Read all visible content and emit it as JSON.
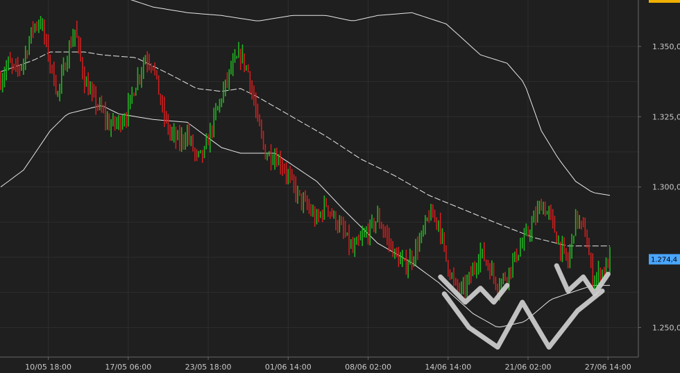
{
  "chart_data": {
    "type": "bar",
    "title": "",
    "xlabel": "",
    "ylabel": "",
    "grid": true,
    "ylim": [
      1.2395,
      1.3665
    ],
    "x_tick_labels": [
      "10/05 18:00",
      "17/05 06:00",
      "23/05 18:00",
      "01/06 14:00",
      "08/06 02:00",
      "14/06 14:00",
      "21/06 02:00",
      "27/06 14:00"
    ],
    "y_tick_labels": [
      {
        "label": "1.350,0",
        "value": 1.35
      },
      {
        "label": "1.325,0",
        "value": 1.325
      },
      {
        "label": "1.300,0",
        "value": 1.3
      },
      {
        "label": "1.250,0",
        "value": 1.25
      }
    ],
    "current_price": {
      "label": "1.274,4",
      "value": 1.2744
    },
    "top_price_tag_color": "#f0b000",
    "current_price_tag_color": "#4aa6ff",
    "up_color": "#22b322",
    "down_color": "#cc1f1f",
    "band_color": "#e8e8e8",
    "annotation_color": "#cfcfcf",
    "price_path": [
      [
        0,
        1.338
      ],
      [
        4,
        1.344
      ],
      [
        8,
        1.341
      ],
      [
        12,
        1.345
      ],
      [
        17,
        1.357
      ],
      [
        21,
        1.359
      ],
      [
        26,
        1.344
      ],
      [
        30,
        1.333
      ],
      [
        35,
        1.347
      ],
      [
        39,
        1.356
      ],
      [
        44,
        1.338
      ],
      [
        48,
        1.332
      ],
      [
        53,
        1.327
      ],
      [
        57,
        1.322
      ],
      [
        62,
        1.323
      ],
      [
        66,
        1.326
      ],
      [
        71,
        1.337
      ],
      [
        76,
        1.346
      ],
      [
        80,
        1.344
      ],
      [
        85,
        1.327
      ],
      [
        89,
        1.319
      ],
      [
        94,
        1.316
      ],
      [
        98,
        1.319
      ],
      [
        103,
        1.31
      ],
      [
        107,
        1.312
      ],
      [
        112,
        1.324
      ],
      [
        116,
        1.332
      ],
      [
        121,
        1.342
      ],
      [
        126,
        1.347
      ],
      [
        130,
        1.341
      ],
      [
        135,
        1.323
      ],
      [
        139,
        1.312
      ],
      [
        144,
        1.311
      ],
      [
        148,
        1.308
      ],
      [
        153,
        1.301
      ],
      [
        157,
        1.296
      ],
      [
        162,
        1.292
      ],
      [
        166,
        1.288
      ],
      [
        171,
        1.294
      ],
      [
        175,
        1.289
      ],
      [
        180,
        1.284
      ],
      [
        185,
        1.277
      ],
      [
        189,
        1.281
      ],
      [
        194,
        1.285
      ],
      [
        198,
        1.289
      ],
      [
        203,
        1.282
      ],
      [
        207,
        1.276
      ],
      [
        212,
        1.272
      ],
      [
        216,
        1.275
      ],
      [
        221,
        1.282
      ],
      [
        225,
        1.29
      ],
      [
        230,
        1.288
      ],
      [
        234,
        1.274
      ],
      [
        239,
        1.264
      ],
      [
        243,
        1.263
      ],
      [
        248,
        1.27
      ],
      [
        252,
        1.277
      ],
      [
        257,
        1.271
      ],
      [
        261,
        1.265
      ],
      [
        266,
        1.269
      ],
      [
        271,
        1.276
      ],
      [
        275,
        1.281
      ],
      [
        280,
        1.288
      ],
      [
        284,
        1.294
      ],
      [
        289,
        1.289
      ],
      [
        293,
        1.28
      ],
      [
        298,
        1.273
      ],
      [
        302,
        1.289
      ],
      [
        307,
        1.284
      ],
      [
        311,
        1.267
      ],
      [
        316,
        1.27
      ],
      [
        320,
        1.274
      ]
    ],
    "ma_line": [
      [
        0,
        1.341
      ],
      [
        17,
        1.345
      ],
      [
        26,
        1.348
      ],
      [
        44,
        1.348
      ],
      [
        53,
        1.347
      ],
      [
        71,
        1.346
      ],
      [
        89,
        1.34
      ],
      [
        103,
        1.335
      ],
      [
        116,
        1.334
      ],
      [
        126,
        1.335
      ],
      [
        135,
        1.332
      ],
      [
        153,
        1.325
      ],
      [
        171,
        1.318
      ],
      [
        189,
        1.31
      ],
      [
        207,
        1.304
      ],
      [
        225,
        1.297
      ],
      [
        243,
        1.292
      ],
      [
        261,
        1.287
      ],
      [
        280,
        1.282
      ],
      [
        298,
        1.279
      ],
      [
        320,
        1.279
      ]
    ],
    "upper_band": [
      [
        0,
        1.372
      ],
      [
        17,
        1.372
      ],
      [
        35,
        1.368
      ],
      [
        62,
        1.368
      ],
      [
        80,
        1.364
      ],
      [
        98,
        1.362
      ],
      [
        116,
        1.361
      ],
      [
        135,
        1.359
      ],
      [
        153,
        1.361
      ],
      [
        171,
        1.361
      ],
      [
        185,
        1.359
      ],
      [
        198,
        1.361
      ],
      [
        216,
        1.362
      ],
      [
        234,
        1.358
      ],
      [
        252,
        1.347
      ],
      [
        266,
        1.344
      ],
      [
        275,
        1.337
      ],
      [
        284,
        1.32
      ],
      [
        293,
        1.31
      ],
      [
        302,
        1.302
      ],
      [
        311,
        1.298
      ],
      [
        320,
        1.297
      ]
    ],
    "lower_band": [
      [
        0,
        1.3
      ],
      [
        12,
        1.306
      ],
      [
        26,
        1.32
      ],
      [
        35,
        1.326
      ],
      [
        53,
        1.329
      ],
      [
        62,
        1.326
      ],
      [
        80,
        1.324
      ],
      [
        98,
        1.323
      ],
      [
        116,
        1.314
      ],
      [
        126,
        1.312
      ],
      [
        144,
        1.312
      ],
      [
        166,
        1.302
      ],
      [
        180,
        1.292
      ],
      [
        198,
        1.28
      ],
      [
        216,
        1.273
      ],
      [
        230,
        1.266
      ],
      [
        248,
        1.255
      ],
      [
        261,
        1.25
      ],
      [
        275,
        1.252
      ],
      [
        289,
        1.26
      ],
      [
        302,
        1.263
      ],
      [
        311,
        1.265
      ],
      [
        320,
        1.265
      ]
    ],
    "annotations": [
      {
        "shape": "W",
        "points": [
          [
            231,
            1.268
          ],
          [
            244,
            1.259
          ],
          [
            252,
            1.264
          ],
          [
            259,
            1.259
          ],
          [
            266,
            1.265
          ]
        ]
      },
      {
        "shape": "W",
        "points": [
          [
            233,
            1.262
          ],
          [
            246,
            1.25
          ],
          [
            261,
            1.243
          ],
          [
            274,
            1.259
          ],
          [
            288,
            1.243
          ],
          [
            303,
            1.256
          ],
          [
            316,
            1.263
          ]
        ]
      },
      {
        "shape": "W",
        "points": [
          [
            292,
            1.272
          ],
          [
            298,
            1.263
          ],
          [
            306,
            1.268
          ],
          [
            312,
            1.262
          ],
          [
            319,
            1.269
          ]
        ]
      }
    ]
  }
}
